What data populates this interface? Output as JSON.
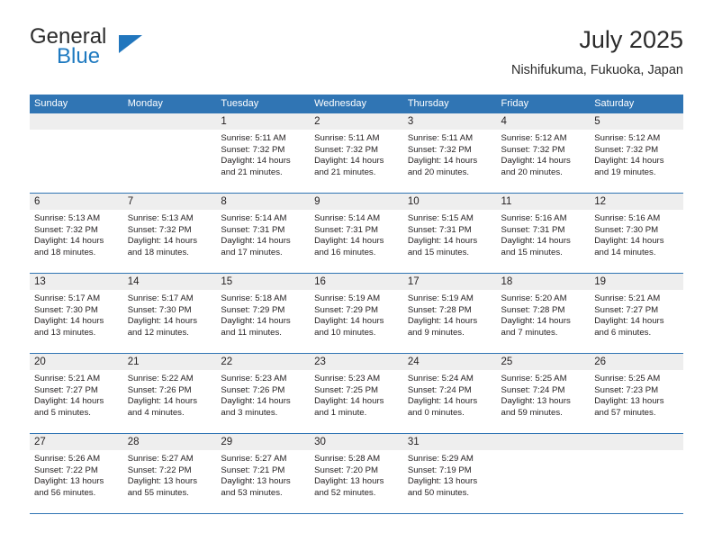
{
  "brand": {
    "line1": "General",
    "line2": "Blue",
    "triangle_color": "#2176bd"
  },
  "header": {
    "title": "July 2025",
    "subtitle": "Nishifukuma, Fukuoka, Japan",
    "accent_color": "#3075b4",
    "daynum_band_color": "#eeeeee"
  },
  "weekdays": [
    "Sunday",
    "Monday",
    "Tuesday",
    "Wednesday",
    "Thursday",
    "Friday",
    "Saturday"
  ],
  "labels": {
    "sunrise": "Sunrise:",
    "sunset": "Sunset:",
    "daylight": "Daylight:"
  },
  "weeks": [
    [
      {
        "day": "",
        "empty": true
      },
      {
        "day": "",
        "empty": true
      },
      {
        "day": "1",
        "sunrise": "Sunrise: 5:11 AM",
        "sunset": "Sunset: 7:32 PM",
        "daylight1": "Daylight: 14 hours",
        "daylight2": "and 21 minutes."
      },
      {
        "day": "2",
        "sunrise": "Sunrise: 5:11 AM",
        "sunset": "Sunset: 7:32 PM",
        "daylight1": "Daylight: 14 hours",
        "daylight2": "and 21 minutes."
      },
      {
        "day": "3",
        "sunrise": "Sunrise: 5:11 AM",
        "sunset": "Sunset: 7:32 PM",
        "daylight1": "Daylight: 14 hours",
        "daylight2": "and 20 minutes."
      },
      {
        "day": "4",
        "sunrise": "Sunrise: 5:12 AM",
        "sunset": "Sunset: 7:32 PM",
        "daylight1": "Daylight: 14 hours",
        "daylight2": "and 20 minutes."
      },
      {
        "day": "5",
        "sunrise": "Sunrise: 5:12 AM",
        "sunset": "Sunset: 7:32 PM",
        "daylight1": "Daylight: 14 hours",
        "daylight2": "and 19 minutes."
      }
    ],
    [
      {
        "day": "6",
        "sunrise": "Sunrise: 5:13 AM",
        "sunset": "Sunset: 7:32 PM",
        "daylight1": "Daylight: 14 hours",
        "daylight2": "and 18 minutes."
      },
      {
        "day": "7",
        "sunrise": "Sunrise: 5:13 AM",
        "sunset": "Sunset: 7:32 PM",
        "daylight1": "Daylight: 14 hours",
        "daylight2": "and 18 minutes."
      },
      {
        "day": "8",
        "sunrise": "Sunrise: 5:14 AM",
        "sunset": "Sunset: 7:31 PM",
        "daylight1": "Daylight: 14 hours",
        "daylight2": "and 17 minutes."
      },
      {
        "day": "9",
        "sunrise": "Sunrise: 5:14 AM",
        "sunset": "Sunset: 7:31 PM",
        "daylight1": "Daylight: 14 hours",
        "daylight2": "and 16 minutes."
      },
      {
        "day": "10",
        "sunrise": "Sunrise: 5:15 AM",
        "sunset": "Sunset: 7:31 PM",
        "daylight1": "Daylight: 14 hours",
        "daylight2": "and 15 minutes."
      },
      {
        "day": "11",
        "sunrise": "Sunrise: 5:16 AM",
        "sunset": "Sunset: 7:31 PM",
        "daylight1": "Daylight: 14 hours",
        "daylight2": "and 15 minutes."
      },
      {
        "day": "12",
        "sunrise": "Sunrise: 5:16 AM",
        "sunset": "Sunset: 7:30 PM",
        "daylight1": "Daylight: 14 hours",
        "daylight2": "and 14 minutes."
      }
    ],
    [
      {
        "day": "13",
        "sunrise": "Sunrise: 5:17 AM",
        "sunset": "Sunset: 7:30 PM",
        "daylight1": "Daylight: 14 hours",
        "daylight2": "and 13 minutes."
      },
      {
        "day": "14",
        "sunrise": "Sunrise: 5:17 AM",
        "sunset": "Sunset: 7:30 PM",
        "daylight1": "Daylight: 14 hours",
        "daylight2": "and 12 minutes."
      },
      {
        "day": "15",
        "sunrise": "Sunrise: 5:18 AM",
        "sunset": "Sunset: 7:29 PM",
        "daylight1": "Daylight: 14 hours",
        "daylight2": "and 11 minutes."
      },
      {
        "day": "16",
        "sunrise": "Sunrise: 5:19 AM",
        "sunset": "Sunset: 7:29 PM",
        "daylight1": "Daylight: 14 hours",
        "daylight2": "and 10 minutes."
      },
      {
        "day": "17",
        "sunrise": "Sunrise: 5:19 AM",
        "sunset": "Sunset: 7:28 PM",
        "daylight1": "Daylight: 14 hours",
        "daylight2": "and 9 minutes."
      },
      {
        "day": "18",
        "sunrise": "Sunrise: 5:20 AM",
        "sunset": "Sunset: 7:28 PM",
        "daylight1": "Daylight: 14 hours",
        "daylight2": "and 7 minutes."
      },
      {
        "day": "19",
        "sunrise": "Sunrise: 5:21 AM",
        "sunset": "Sunset: 7:27 PM",
        "daylight1": "Daylight: 14 hours",
        "daylight2": "and 6 minutes."
      }
    ],
    [
      {
        "day": "20",
        "sunrise": "Sunrise: 5:21 AM",
        "sunset": "Sunset: 7:27 PM",
        "daylight1": "Daylight: 14 hours",
        "daylight2": "and 5 minutes."
      },
      {
        "day": "21",
        "sunrise": "Sunrise: 5:22 AM",
        "sunset": "Sunset: 7:26 PM",
        "daylight1": "Daylight: 14 hours",
        "daylight2": "and 4 minutes."
      },
      {
        "day": "22",
        "sunrise": "Sunrise: 5:23 AM",
        "sunset": "Sunset: 7:26 PM",
        "daylight1": "Daylight: 14 hours",
        "daylight2": "and 3 minutes."
      },
      {
        "day": "23",
        "sunrise": "Sunrise: 5:23 AM",
        "sunset": "Sunset: 7:25 PM",
        "daylight1": "Daylight: 14 hours",
        "daylight2": "and 1 minute."
      },
      {
        "day": "24",
        "sunrise": "Sunrise: 5:24 AM",
        "sunset": "Sunset: 7:24 PM",
        "daylight1": "Daylight: 14 hours",
        "daylight2": "and 0 minutes."
      },
      {
        "day": "25",
        "sunrise": "Sunrise: 5:25 AM",
        "sunset": "Sunset: 7:24 PM",
        "daylight1": "Daylight: 13 hours",
        "daylight2": "and 59 minutes."
      },
      {
        "day": "26",
        "sunrise": "Sunrise: 5:25 AM",
        "sunset": "Sunset: 7:23 PM",
        "daylight1": "Daylight: 13 hours",
        "daylight2": "and 57 minutes."
      }
    ],
    [
      {
        "day": "27",
        "sunrise": "Sunrise: 5:26 AM",
        "sunset": "Sunset: 7:22 PM",
        "daylight1": "Daylight: 13 hours",
        "daylight2": "and 56 minutes."
      },
      {
        "day": "28",
        "sunrise": "Sunrise: 5:27 AM",
        "sunset": "Sunset: 7:22 PM",
        "daylight1": "Daylight: 13 hours",
        "daylight2": "and 55 minutes."
      },
      {
        "day": "29",
        "sunrise": "Sunrise: 5:27 AM",
        "sunset": "Sunset: 7:21 PM",
        "daylight1": "Daylight: 13 hours",
        "daylight2": "and 53 minutes."
      },
      {
        "day": "30",
        "sunrise": "Sunrise: 5:28 AM",
        "sunset": "Sunset: 7:20 PM",
        "daylight1": "Daylight: 13 hours",
        "daylight2": "and 52 minutes."
      },
      {
        "day": "31",
        "sunrise": "Sunrise: 5:29 AM",
        "sunset": "Sunset: 7:19 PM",
        "daylight1": "Daylight: 13 hours",
        "daylight2": "and 50 minutes."
      },
      {
        "day": "",
        "empty": true
      },
      {
        "day": "",
        "empty": true
      }
    ]
  ]
}
